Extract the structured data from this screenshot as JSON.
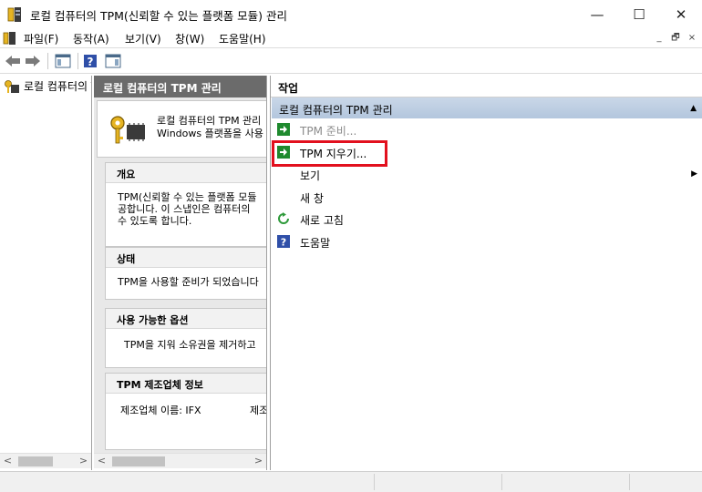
{
  "window": {
    "title": "로컬 컴퓨터의 TPM(신뢰할 수 있는 플랫폼 모듈) 관리",
    "controls": {
      "minimize": "—",
      "maximize": "☐",
      "close": "✕"
    }
  },
  "menubar": {
    "items": [
      "파일(F)",
      "동작(A)",
      "보기(V)",
      "창(W)",
      "도움말(H)"
    ],
    "mdi_controls": [
      "_",
      "🗗",
      "×"
    ]
  },
  "toolbar": {
    "buttons": [
      "back-icon",
      "forward-icon",
      "show-hide-console-tree-icon",
      "help-icon",
      "show-hide-action-pane-icon"
    ]
  },
  "tree": {
    "root_label": "로컬 컴퓨터의 TPM 관리"
  },
  "center": {
    "header": "로컬 컴퓨터의 TPM 관리",
    "intro_line1": "로컬 컴퓨터의 TPM 관리",
    "intro_line2": "Windows 플랫폼을 사용",
    "sections": [
      {
        "title": "개요",
        "lines": [
          "TPM(신뢰할 수 있는 플랫폼 모듈",
          "공합니다. 이 스냅인은 컴퓨터의",
          "수 있도록 합니다."
        ]
      },
      {
        "title": "상태",
        "lines": [
          "TPM을 사용할 준비가 되었습니다"
        ]
      },
      {
        "title": "사용 가능한 옵션",
        "lines": [
          "TPM을 지워 소유권을 제거하고"
        ]
      },
      {
        "title": "TPM 제조업체 정보",
        "lines": [
          "제조업체 이름:  IFX",
          "제조"
        ]
      }
    ]
  },
  "actions": {
    "title": "작업",
    "group": "로컬 컴퓨터의 TPM 관리",
    "items": [
      {
        "label": "TPM 준비...",
        "icon": "green-arrow-icon",
        "disabled": true
      },
      {
        "label": "TPM 지우기...",
        "icon": "green-arrow-icon",
        "disabled": false
      },
      {
        "label": "보기",
        "icon": "",
        "disabled": false
      },
      {
        "label": "새 창",
        "icon": "",
        "disabled": false
      },
      {
        "label": "새로 고침",
        "icon": "refresh-icon",
        "disabled": false
      },
      {
        "label": "도움말",
        "icon": "help-icon",
        "disabled": false
      }
    ]
  },
  "colors": {
    "highlight": "#e2101e",
    "header_bg": "#6b6b6b",
    "group_bg": "#c9d7e8",
    "disabled_text": "#8a8a8a"
  }
}
